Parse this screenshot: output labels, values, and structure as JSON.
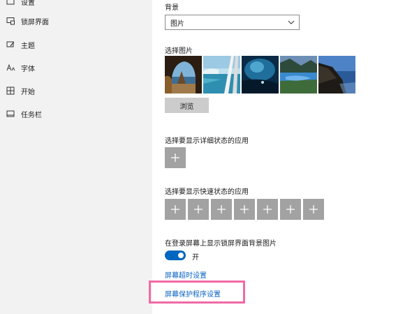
{
  "sidebar": {
    "items": [
      {
        "label": "设置",
        "icon": "settings-icon"
      },
      {
        "label": "锁屏界面",
        "icon": "lock-screen-icon"
      },
      {
        "label": "主题",
        "icon": "theme-icon"
      },
      {
        "label": "字体",
        "icon": "font-icon"
      },
      {
        "label": "开始",
        "icon": "start-icon"
      },
      {
        "label": "任务栏",
        "icon": "taskbar-icon"
      }
    ]
  },
  "main": {
    "background_label": "背景",
    "background_value": "图片",
    "choose_picture_label": "选择图片",
    "browse_label": "浏览",
    "detailed_status_label": "选择要显示详细状态的应用",
    "quick_status_label": "选择要显示快速状态的应用",
    "show_bg_on_signin_label": "在登录屏幕上显示锁屏界面背景图片",
    "toggle_state": "开",
    "timeout_link": "屏幕超时设置",
    "screensaver_link": "屏幕保护程序设置"
  },
  "colors": {
    "accent": "#0067c0",
    "link": "#0a63c2",
    "highlight": "#f06aa5",
    "sidebar_bg": "#f2f2f2",
    "plus_button_bg": "#a2a2a2"
  }
}
